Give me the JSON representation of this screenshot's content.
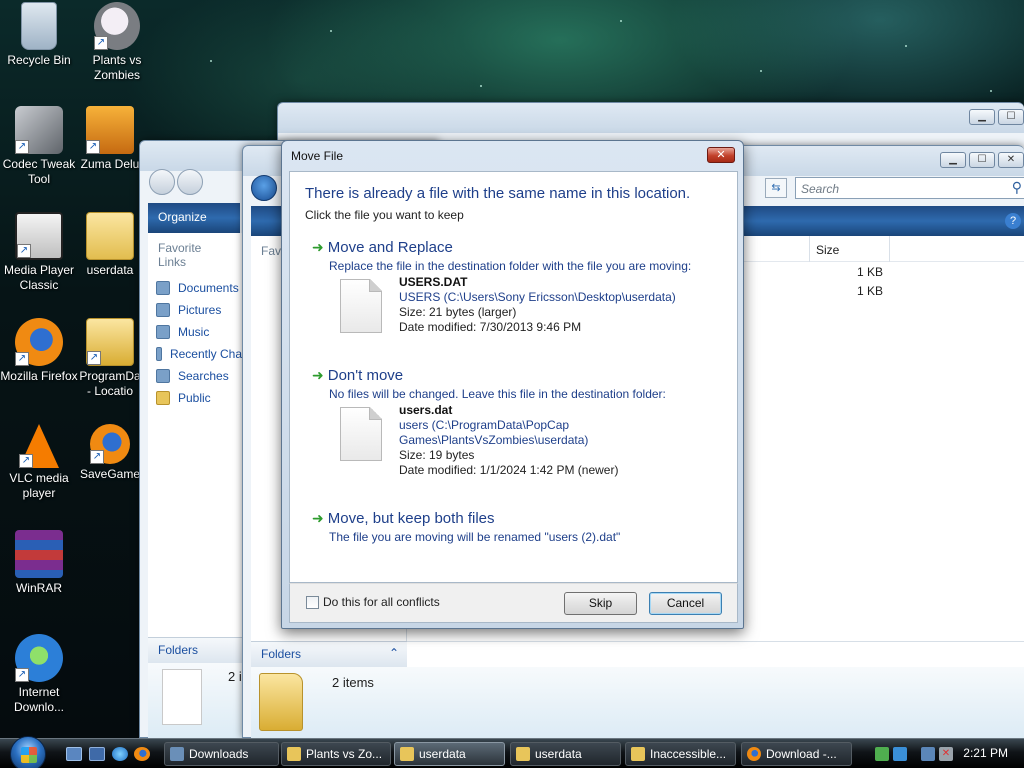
{
  "desktop": {
    "icons": [
      {
        "label": "Recycle Bin",
        "icon": "recycle-bin-icon"
      },
      {
        "label": "Plants vs Zombies",
        "icon": "plants-vs-zombies-icon"
      },
      {
        "label": "Codec Tweak Tool",
        "icon": "codec-tweak-tool-icon"
      },
      {
        "label": "Zuma Delu",
        "icon": "zuma-deluxe-icon"
      },
      {
        "label": "Media Player Classic",
        "icon": "media-player-classic-icon"
      },
      {
        "label": "userdata",
        "icon": "folder-icon"
      },
      {
        "label": "Mozilla Firefox",
        "icon": "firefox-icon"
      },
      {
        "label": "ProgramDa - Locatio",
        "icon": "folder-icon"
      },
      {
        "label": "VLC media player",
        "icon": "vlc-icon"
      },
      {
        "label": "SaveGame",
        "icon": "firefox-icon"
      },
      {
        "label": "WinRAR",
        "icon": "winrar-icon"
      },
      {
        "label": "Internet Downlo...",
        "icon": "internet-download-manager-icon"
      }
    ]
  },
  "explorer_back": {
    "toolbar": {
      "organize": "Organize"
    },
    "favorite_links_header": "Favorite Links",
    "favorite_links": [
      "Documents",
      "Pictures",
      "Music",
      "Recently Cha",
      "Searches",
      "Public"
    ],
    "folders_label": "Folders",
    "details_count": "2 i"
  },
  "explorer_front": {
    "search_placeholder": "Search",
    "column_size": "Size",
    "sizes": [
      "1 KB",
      "1 KB"
    ],
    "side_header": "Favi",
    "folders_label": "Folders",
    "details_count": "2 items"
  },
  "dialog": {
    "title": "Move File",
    "heading": "There is already a file with the same name in this location.",
    "subheading": "Click the file you want to keep",
    "option_replace": {
      "title": "Move and Replace",
      "description": "Replace the file in the destination folder with the file you are moving:",
      "file_name": "USERS.DAT",
      "location": "USERS (C:\\Users\\Sony Ericsson\\Desktop\\userdata)",
      "size": "Size: 21 bytes (larger)",
      "modified": "Date modified: 7/30/2013 9:46 PM"
    },
    "option_keep": {
      "title": "Don't move",
      "description": "No files will be changed. Leave this file in the destination folder:",
      "file_name": "users.dat",
      "location_line1": "users (C:\\ProgramData\\PopCap",
      "location_line2": "Games\\PlantsVsZombies\\userdata)",
      "size": "Size: 19 bytes",
      "modified": "Date modified: 1/1/2024 1:42 PM (newer)"
    },
    "option_both": {
      "title": "Move, but keep both files",
      "description": "The file you are moving will be renamed \"users (2).dat\""
    },
    "checkbox_label": "Do this for all conflicts",
    "skip_label": "Skip",
    "cancel_label": "Cancel",
    "close_glyph": "✕"
  },
  "taskbar": {
    "tasks": [
      {
        "label": "Downloads",
        "icon": "downloads-folder-icon"
      },
      {
        "label": "Plants vs Zo...",
        "icon": "folder-icon"
      },
      {
        "label": "userdata",
        "icon": "folder-icon"
      },
      {
        "label": "userdata",
        "icon": "folder-icon"
      },
      {
        "label": "Inaccessible...",
        "icon": "folder-icon"
      },
      {
        "label": "Download -...",
        "icon": "firefox-icon"
      }
    ],
    "clock": "2:21 PM"
  }
}
